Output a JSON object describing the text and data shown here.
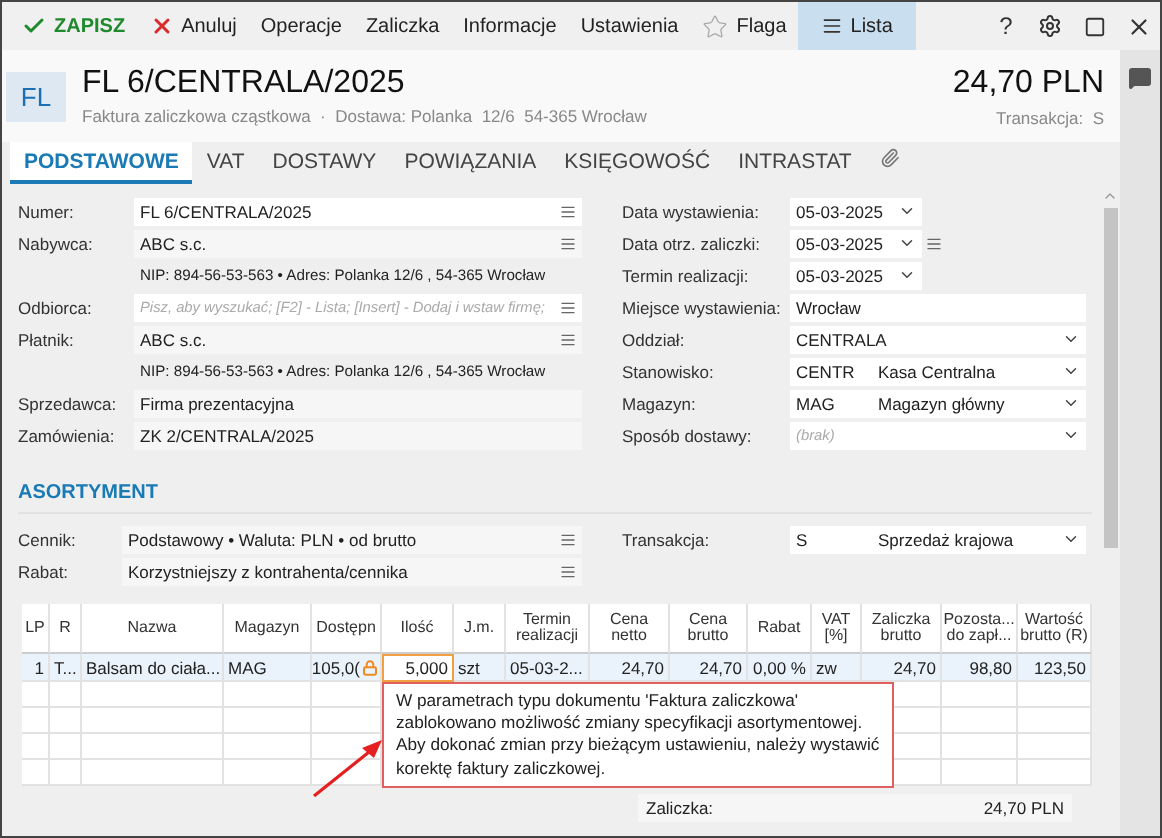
{
  "toolbar": {
    "buttons": [
      {
        "label": "ZAPISZ",
        "kind": "save",
        "selected": false
      },
      {
        "label": "Anuluj",
        "kind": "cancel",
        "selected": false
      },
      {
        "label": "Operacje",
        "kind": "plain",
        "selected": false
      },
      {
        "label": "Zaliczka",
        "kind": "plain",
        "selected": false
      },
      {
        "label": "Informacje",
        "kind": "plain",
        "selected": false
      },
      {
        "label": "Ustawienia",
        "kind": "plain",
        "selected": false
      },
      {
        "label": "Flaga",
        "kind": "flag",
        "selected": false
      },
      {
        "label": "Lista",
        "kind": "list",
        "selected": true
      }
    ],
    "help": "?"
  },
  "header": {
    "avatar": "FL",
    "title": "FL 6/CENTRALA/2025",
    "subtitle": "Faktura zaliczkowa cząstkowa  ·  Dostawa: Polanka  12/6  54-365 Wrocław",
    "amount": "24,70 PLN",
    "transaction": "Transakcja:  S"
  },
  "tabs": [
    {
      "label": "PODSTAWOWE",
      "selected": true
    },
    {
      "label": "VAT",
      "selected": false
    },
    {
      "label": "DOSTAWY",
      "selected": false
    },
    {
      "label": "POWIĄZANIA",
      "selected": false
    },
    {
      "label": "KSIĘGOWOŚĆ",
      "selected": false
    },
    {
      "label": "INTRASTAT",
      "selected": false
    }
  ],
  "left_fields": [
    {
      "kind": "input",
      "label": "Numer:",
      "value": "FL 6/CENTRALA/2025",
      "menu": true
    },
    {
      "kind": "readonly",
      "label": "Nabywca:",
      "value": "ABC s.c.",
      "menu": true
    },
    {
      "kind": "info",
      "value": "NIP:  894-56-53-563  •  Adres:  Polanka  12/6 , 54-365 Wrocław"
    },
    {
      "kind": "input",
      "label": "Odbiorca:",
      "placeholder": "Pisz, aby wyszukać; [F2] - Lista; [Insert] - Dodaj i wstaw firmę;",
      "menu": true
    },
    {
      "kind": "readonly",
      "label": "Płatnik:",
      "value": "ABC s.c.",
      "menu": true
    },
    {
      "kind": "info",
      "value": "NIP:  894-56-53-563  •  Adres:  Polanka  12/6 , 54-365 Wrocław"
    },
    {
      "kind": "readonly",
      "label": "Sprzedawca:",
      "value": "Firma prezentacyjna",
      "menu": false
    },
    {
      "kind": "readonly",
      "label": "Zamówienia:",
      "value": "ZK 2/CENTRALA/2025",
      "menu": false
    }
  ],
  "right_fields": [
    {
      "kind": "date",
      "label": "Data wystawienia:",
      "value": "05-03-2025",
      "menu": false
    },
    {
      "kind": "date",
      "label": "Data otrz. zaliczki:",
      "value": "05-03-2025",
      "menu": true
    },
    {
      "kind": "date",
      "label": "Termin realizacji:",
      "value": "05-03-2025",
      "menu": false
    },
    {
      "kind": "text",
      "label": "Miejsce wystawienia:",
      "value": "Wrocław",
      "menu": false
    },
    {
      "kind": "select",
      "label": "Oddział:",
      "value": "CENTRALA",
      "menu": false
    },
    {
      "kind": "select",
      "label": "Stanowisko:",
      "code": "CENTR",
      "value": "Kasa Centralna",
      "menu": false
    },
    {
      "kind": "select",
      "label": "Magazyn:",
      "code": "MAG",
      "value": "Magazyn główny",
      "menu": false
    },
    {
      "kind": "select",
      "label": "Sposób dostawy:",
      "placeholder": "(brak)",
      "menu": false
    }
  ],
  "section": "ASORTYMENT",
  "pricing": [
    {
      "label": "Cennik:",
      "value": "Podstawowy • Waluta: PLN • od brutto"
    },
    {
      "label": "Rabat:",
      "value": "Korzystniejszy z kontrahenta/cennika"
    }
  ],
  "transaction": {
    "label": "Transakcja:",
    "code": "S",
    "value": "Sprzedaż krajowa"
  },
  "table": {
    "columns": [
      "LP",
      "R",
      "Nazwa",
      "Magazyn",
      "Dostępn",
      "Ilość",
      "J.m.",
      "Termin realizacji",
      "Cena netto",
      "Cena brutto",
      "Rabat",
      "VAT [%]",
      "Zaliczka brutto",
      "Pozosta... do zapł...",
      "Wartość brutto (R)"
    ],
    "rows": [
      {
        "selected": true,
        "cells": [
          {
            "text": "1",
            "locked": false,
            "focused": false
          },
          {
            "text": "T...",
            "locked": false,
            "focused": false
          },
          {
            "text": "Balsam do ciała...",
            "locked": false,
            "focused": false
          },
          {
            "text": "MAG",
            "locked": false,
            "focused": false
          },
          {
            "text": "105,0(",
            "locked": true,
            "focused": false
          },
          {
            "text": "5,000",
            "locked": false,
            "focused": true
          },
          {
            "text": "szt",
            "locked": false,
            "focused": false
          },
          {
            "text": "05-03-2...",
            "locked": false,
            "focused": false
          },
          {
            "text": "24,70",
            "locked": false,
            "focused": false
          },
          {
            "text": "24,70",
            "locked": false,
            "focused": false
          },
          {
            "text": "0,00 %",
            "locked": false,
            "focused": false
          },
          {
            "text": "zw",
            "locked": false,
            "focused": false
          },
          {
            "text": "24,70",
            "locked": false,
            "focused": false
          },
          {
            "text": "98,80",
            "locked": false,
            "focused": false
          },
          {
            "text": "123,50",
            "locked": false,
            "focused": false
          }
        ]
      }
    ]
  },
  "tooltip": "W parametrach typu dokumentu 'Faktura zaliczkowa' zablokowano możliwość zmiany specyfikacji asortymentowej. Aby dokonać zmian przy bieżącym ustawieniu, należy wystawić korektę faktury zaliczkowej.",
  "footer": {
    "label": "Zaliczka:",
    "value": "24,70 PLN"
  }
}
